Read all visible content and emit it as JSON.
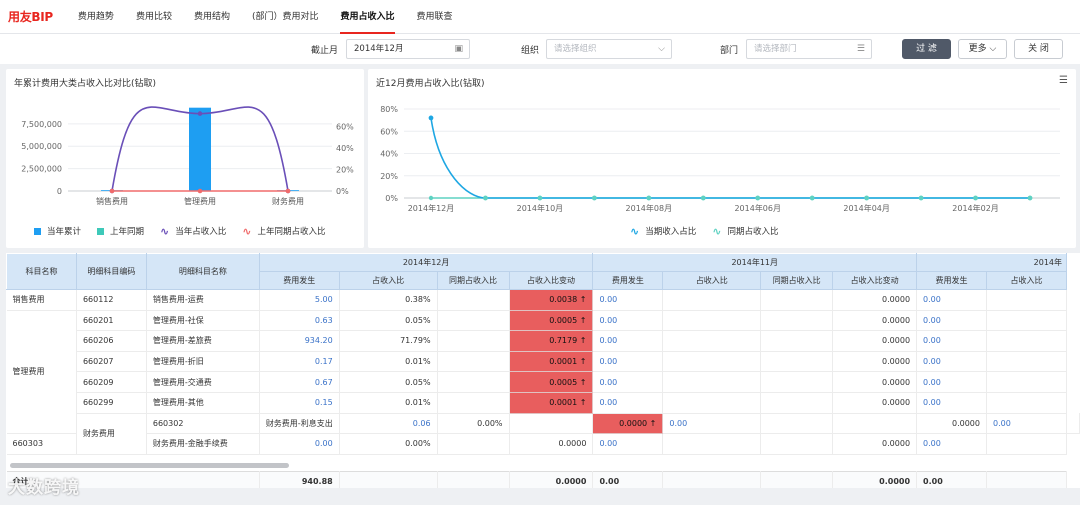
{
  "app": {
    "logo": "用友BIP"
  },
  "nav": {
    "tabs": [
      {
        "label": "费用趋势"
      },
      {
        "label": "费用比较"
      },
      {
        "label": "费用结构"
      },
      {
        "label": "(部门）费用对比"
      },
      {
        "label": "费用占收入比"
      },
      {
        "label": "费用联查"
      }
    ],
    "active_index": 4
  },
  "filters": {
    "date_label": "截止月",
    "date_value": "2014年12月",
    "org_label": "组织",
    "org_placeholder": "请选择组织",
    "dept_label": "部门",
    "dept_placeholder": "请选择部门",
    "filter_button": "过 滤",
    "more_button": "更多",
    "close_button": "关 闭"
  },
  "left_chart": {
    "title": "年累计费用大类占收入比对比(钻取)",
    "legend": [
      "当年累计",
      "上年同期",
      "当年占收入比",
      "上年同期占收入比"
    ],
    "colors": {
      "current": "#1e9ef2",
      "prior": "#3ec9b9",
      "ratio": "#6a4fb8",
      "prior_ratio": "#f06b6b"
    }
  },
  "right_chart": {
    "title": "近12月费用占收入比(钻取)",
    "legend": [
      "当期收入占比",
      "同期占收入比"
    ],
    "colors": {
      "current": "#1ea7e3",
      "prior": "#5fd2c2"
    }
  },
  "chart_data": [
    {
      "type": "bar",
      "categories": [
        "销售费用",
        "管理费用",
        "财务费用"
      ],
      "series": [
        {
          "name": "当年累计",
          "kind": "bar",
          "axis": "left",
          "values": [
            5,
            934,
            0.06
          ]
        },
        {
          "name": "上年同期",
          "kind": "bar",
          "axis": "left",
          "values": [
            0,
            0,
            0
          ]
        },
        {
          "name": "当年占收入比",
          "kind": "line",
          "axis": "right",
          "values": [
            0,
            72,
            0
          ]
        },
        {
          "name": "上年同期占收入比",
          "kind": "line",
          "axis": "right",
          "values": [
            0,
            0,
            0
          ]
        }
      ],
      "y_left": {
        "ticks": [
          "0",
          "2,500,000",
          "5,000,000",
          "7,500,000"
        ]
      },
      "y_right": {
        "ticks": [
          "0%",
          "20%",
          "40%",
          "60%"
        ]
      },
      "y_left_range": [
        0,
        9600000
      ],
      "bar_value_display": 9300000,
      "y_right_range": [
        0,
        80
      ]
    },
    {
      "type": "line",
      "x": [
        "2014年12月",
        "2014年11月",
        "2014年10月",
        "2014年09月",
        "2014年08月",
        "2014年07月",
        "2014年06月",
        "2014年05月",
        "2014年04月",
        "2014年03月",
        "2014年02月",
        "2014年01月"
      ],
      "x_tick_labels": [
        "2014年12月",
        "",
        "2014年10月",
        "",
        "2014年08月",
        "",
        "2014年06月",
        "",
        "2014年04月",
        "",
        "2014年02月",
        ""
      ],
      "y_ticks": [
        "0%",
        "20%",
        "40%",
        "60%",
        "80%"
      ],
      "y_range": [
        0,
        80
      ],
      "series": [
        {
          "name": "当期收入占比",
          "values": [
            72,
            0,
            0,
            0,
            0,
            0,
            0,
            0,
            0,
            0,
            0,
            0
          ]
        },
        {
          "name": "同期占收入比",
          "values": [
            0,
            0,
            0,
            0,
            0,
            0,
            0,
            0,
            0,
            0,
            0,
            0
          ]
        }
      ]
    }
  ],
  "table": {
    "fixed_headers": [
      "科目名称",
      "明细科目编码",
      "明细科目名称"
    ],
    "month_headers": [
      "2014年12月",
      "2014年11月",
      "2014年"
    ],
    "sub_headers": [
      "费用发生",
      "占收入比",
      "同期占收入比",
      "占收入比变动"
    ],
    "groups": [
      "销售费用",
      "管理费用",
      "财务费用"
    ],
    "rows": [
      {
        "code": "660112",
        "name": "销售费用-运费",
        "m12_cost": "5.00",
        "m12_ratio": "0.38%",
        "m12_change": "0.0038 ↑",
        "m11_cost": "0.00",
        "m11_change": "0.0000",
        "m10_cost": "0.00"
      },
      {
        "code": "660201",
        "name": "管理费用-社保",
        "m12_cost": "0.63",
        "m12_ratio": "0.05%",
        "m12_change": "0.0005 ↑",
        "m11_cost": "0.00",
        "m11_change": "0.0000",
        "m10_cost": "0.00"
      },
      {
        "code": "660206",
        "name": "管理费用-差旅费",
        "m12_cost": "934.20",
        "m12_ratio": "71.79%",
        "m12_change": "0.7179 ↑",
        "m11_cost": "0.00",
        "m11_change": "0.0000",
        "m10_cost": "0.00"
      },
      {
        "code": "660207",
        "name": "管理费用-折旧",
        "m12_cost": "0.17",
        "m12_ratio": "0.01%",
        "m12_change": "0.0001 ↑",
        "m11_cost": "0.00",
        "m11_change": "0.0000",
        "m10_cost": "0.00"
      },
      {
        "code": "660209",
        "name": "管理费用-交通费",
        "m12_cost": "0.67",
        "m12_ratio": "0.05%",
        "m12_change": "0.0005 ↑",
        "m11_cost": "0.00",
        "m11_change": "0.0000",
        "m10_cost": "0.00"
      },
      {
        "code": "660299",
        "name": "管理费用-其他",
        "m12_cost": "0.15",
        "m12_ratio": "0.01%",
        "m12_change": "0.0001 ↑",
        "m11_cost": "0.00",
        "m11_change": "0.0000",
        "m10_cost": "0.00"
      },
      {
        "code": "660302",
        "name": "财务费用-利息支出",
        "m12_cost": "0.06",
        "m12_ratio": "0.00%",
        "m12_change": "0.0000 ↑",
        "m11_cost": "0.00",
        "m11_change": "0.0000",
        "m10_cost": "0.00"
      },
      {
        "code": "660303",
        "name": "财务费用-金融手续费",
        "m12_cost": "0.00",
        "m12_ratio": "0.00%",
        "m12_change": "0.0000",
        "m11_cost": "0.00",
        "m11_change": "0.0000",
        "m10_cost": "0.00"
      }
    ],
    "total": {
      "label": "合计",
      "m12_cost": "940.88",
      "m12_change": "0.0000",
      "m11_cost": "0.00",
      "m11_change": "0.0000",
      "m10_cost": "0.00"
    }
  },
  "watermark": "大数跨境"
}
